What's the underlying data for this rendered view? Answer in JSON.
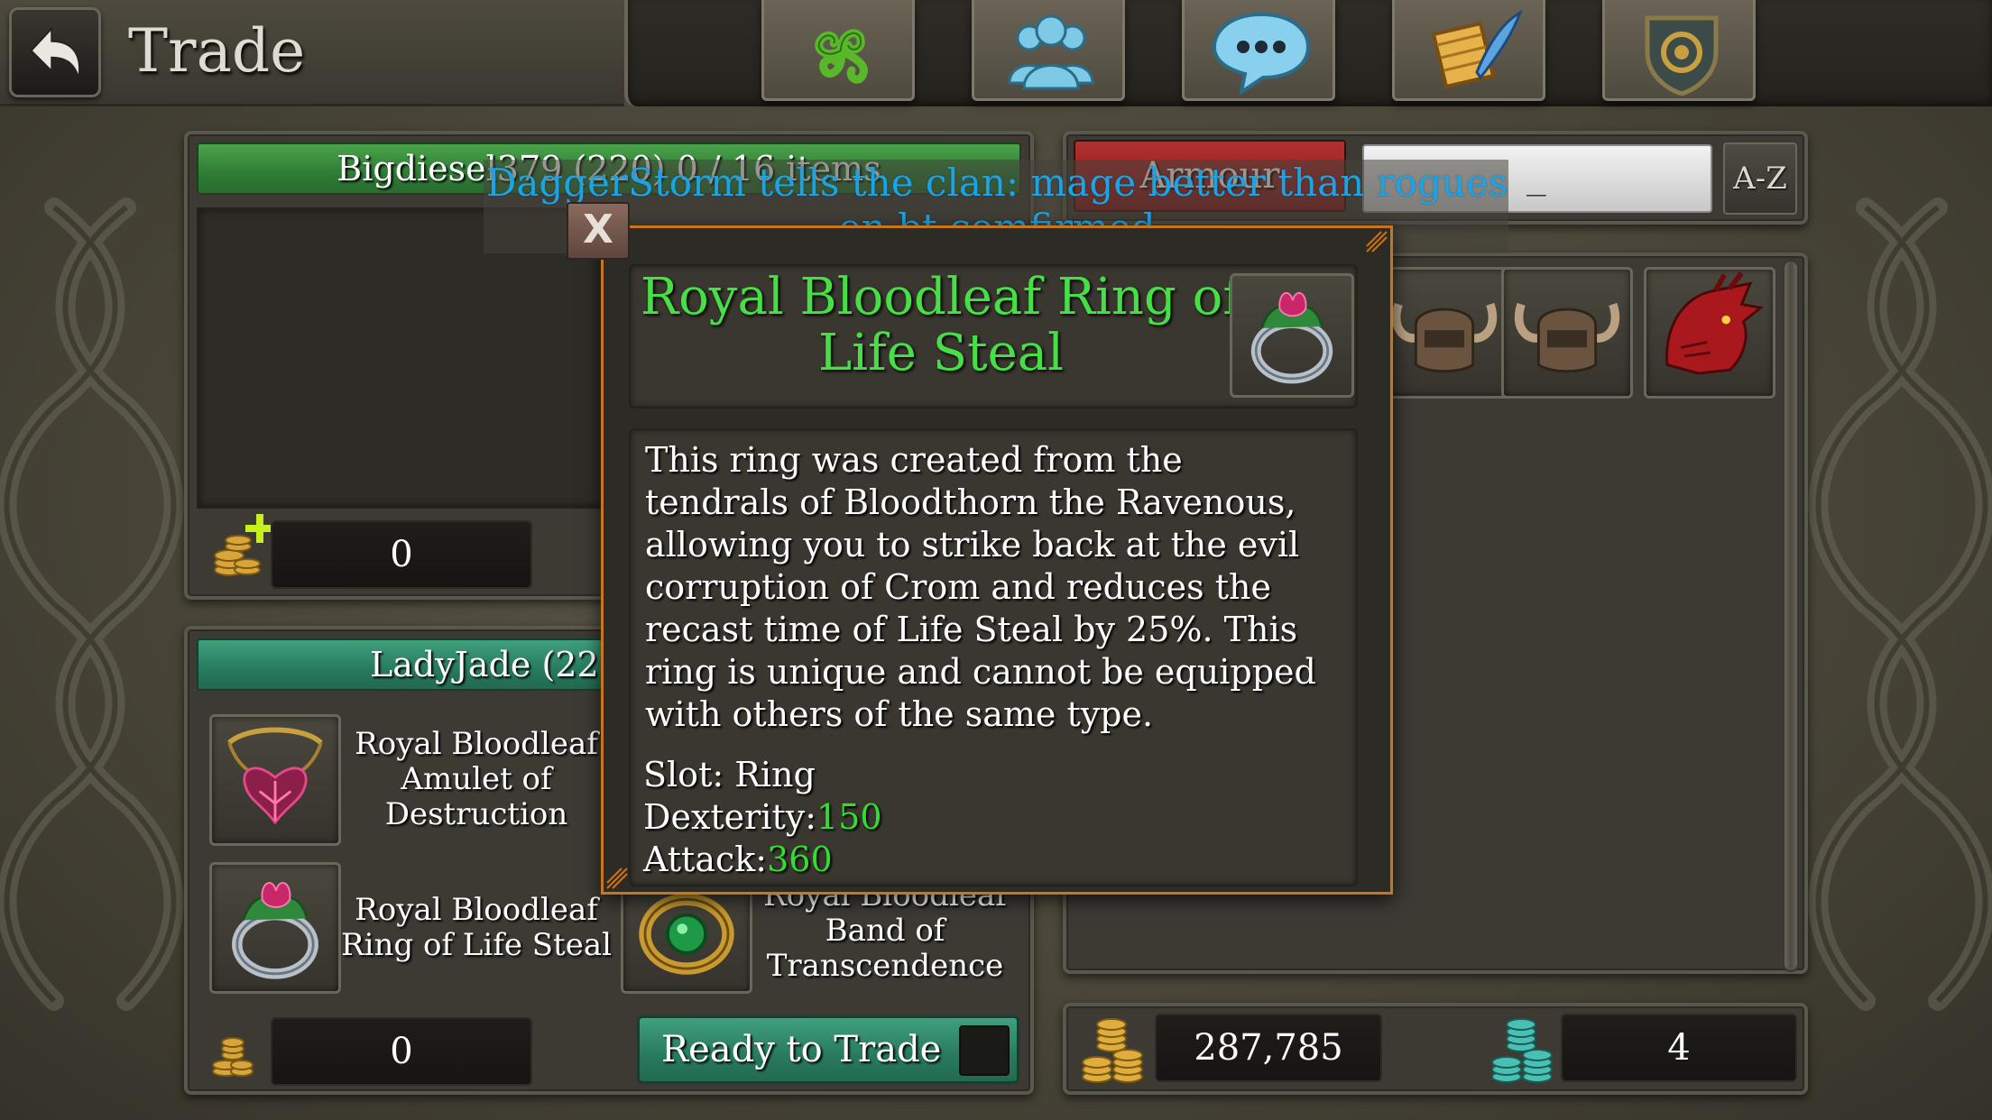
{
  "window": {
    "title": "Trade"
  },
  "top_tabs": [
    {
      "icon": "triskelion-icon"
    },
    {
      "icon": "group-icon"
    },
    {
      "icon": "chat-bubble-icon"
    },
    {
      "icon": "scroll-quill-icon"
    },
    {
      "icon": "clan-shield-icon"
    }
  ],
  "other_player": {
    "header": "Bigdiesel379 (220) 0 / 16 items",
    "gold_offer": "0"
  },
  "my_player": {
    "header": "LadyJade (22",
    "gold_offer": "0",
    "items": [
      {
        "name": "Royal Bloodleaf Amulet of Destruction",
        "name_lines": [
          "Royal Bloodleaf",
          "Amulet of",
          "Destruction"
        ],
        "icon": "amulet-icon"
      },
      {
        "name": "Royal Bloodleaf Ring of Life Steal",
        "name_lines": [
          "Royal Bloodleaf",
          "Ring of Life Steal"
        ],
        "icon": "ring-icon"
      },
      {
        "name": "Royal Bloodleaf Band of Transcendence",
        "name_lines": [
          "Royal Bloodleaf",
          "Band of",
          "Transcendence"
        ],
        "icon": "band-icon"
      }
    ],
    "ready_label": "Ready to Trade"
  },
  "inventory": {
    "filter_label": "Armour",
    "search_value": "_",
    "sort_label": "A-Z",
    "items": [
      {
        "icon": "horned-helm-icon"
      },
      {
        "icon": "horned-helm-icon"
      },
      {
        "icon": "red-dragon-helm-icon"
      }
    ],
    "gold": "287,785",
    "gems": "4"
  },
  "chat": {
    "message": "DaggerStorm tells the clan: mage better than rogues on bt comfirmed",
    "line1": "DaggerStorm tells the clan: mage better than rogues",
    "line2": "on bt comfirmed"
  },
  "tooltip": {
    "close_label": "X",
    "title_line1": "Royal Bloodleaf Ring of",
    "title_line2": "Life Steal",
    "description_lines": [
      "This ring was created from the",
      "tendrals of Bloodthorn the Ravenous,",
      "allowing you to strike back at the evil",
      "corruption of Crom and reduces the",
      "recast time of Life Steal by 25%. This",
      "ring is unique and cannot be equipped",
      "with others of the same type."
    ],
    "stats": [
      {
        "label": "Slot:",
        "value": "Ring"
      },
      {
        "label": "Dexterity:",
        "value": "150"
      },
      {
        "label": "Attack:",
        "value": "360"
      }
    ]
  },
  "colors": {
    "title_green": "#46e046",
    "stat_green": "#2fe02f",
    "chat_blue": "#1aa3e6",
    "tooltip_border": "#c8761e",
    "filter_red": "#b23030"
  }
}
